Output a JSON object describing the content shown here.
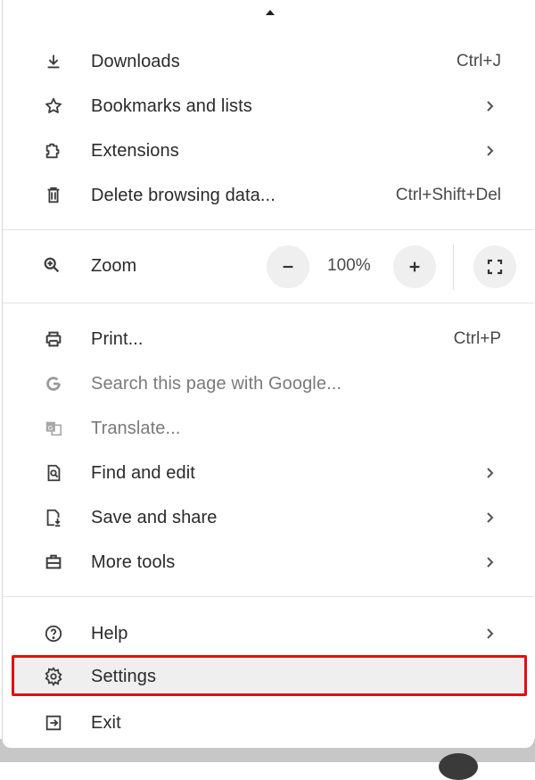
{
  "menu": {
    "section1": [
      {
        "label": "Downloads",
        "shortcut": "Ctrl+J",
        "icon": "download-icon"
      },
      {
        "label": "Bookmarks and lists",
        "submenu": true,
        "icon": "star-icon"
      },
      {
        "label": "Extensions",
        "submenu": true,
        "icon": "puzzle-icon"
      },
      {
        "label": "Delete browsing data...",
        "shortcut": "Ctrl+Shift+Del",
        "icon": "trash-icon"
      }
    ],
    "zoom": {
      "label": "Zoom",
      "value": "100%",
      "decrease_icon": "minus-icon",
      "increase_icon": "plus-icon",
      "fullscreen_icon": "fullscreen-icon"
    },
    "section2": [
      {
        "label": "Print...",
        "shortcut": "Ctrl+P",
        "icon": "printer-icon"
      },
      {
        "label": "Search this page with Google...",
        "disabled": true,
        "icon": "google-icon"
      },
      {
        "label": "Translate...",
        "disabled": true,
        "icon": "translate-icon"
      },
      {
        "label": "Find and edit",
        "submenu": true,
        "icon": "find-page-icon"
      },
      {
        "label": "Save and share",
        "submenu": true,
        "icon": "save-file-icon"
      },
      {
        "label": "More tools",
        "submenu": true,
        "icon": "toolbox-icon"
      }
    ],
    "section3": [
      {
        "label": "Help",
        "submenu": true,
        "icon": "help-icon"
      },
      {
        "label": "Settings",
        "highlighted": true,
        "icon": "gear-icon"
      },
      {
        "label": "Exit",
        "icon": "exit-icon"
      }
    ]
  },
  "colors": {
    "highlight_border": "#e01010",
    "highlight_fill": "#efefef",
    "text": "#2a2a2a",
    "disabled_text": "#7a7a7a"
  }
}
